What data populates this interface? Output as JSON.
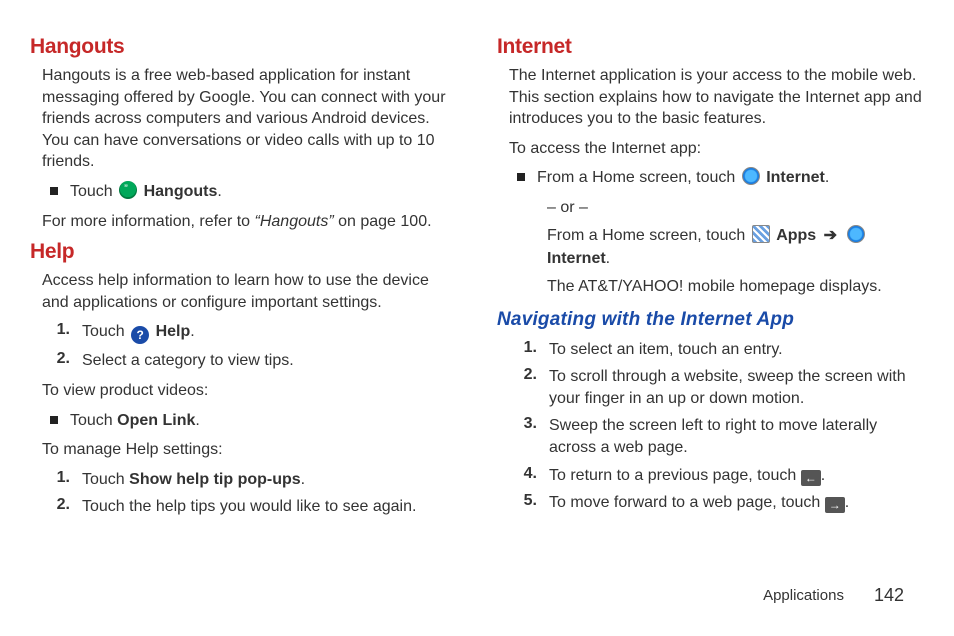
{
  "left": {
    "hangouts": {
      "heading": "Hangouts",
      "desc": "Hangouts is a free web-based application for instant messaging offered by Google. You can connect with your friends across computers and various Android devices. You can have conversations or video calls with up to 10 friends.",
      "bullet_prefix": "Touch ",
      "bullet_bold": "Hangouts",
      "bullet_suffix": ".",
      "ref_prefix": "For more information, refer to ",
      "ref_italic": "“Hangouts”",
      "ref_suffix": " on page 100."
    },
    "help": {
      "heading": "Help",
      "desc": "Access help information to learn how to use the device and applications or configure important settings.",
      "step1_prefix": "Touch ",
      "step1_bold": "Help",
      "step1_suffix": ".",
      "step2": "Select a category to view tips.",
      "videos_para": "To view product videos:",
      "videos_bullet_prefix": "Touch ",
      "videos_bullet_bold": "Open Link",
      "videos_bullet_suffix": ".",
      "settings_para": "To manage Help settings:",
      "setstep1_prefix": "Touch ",
      "setstep1_bold": "Show help tip pop-ups",
      "setstep1_suffix": ".",
      "setstep2": "Touch the help tips you would like to see again.",
      "n1": "1.",
      "n2": "2."
    }
  },
  "right": {
    "internet": {
      "heading": "Internet",
      "desc": "The Internet application is your access to the mobile web. This section explains how to navigate the Internet app and introduces you to the basic features.",
      "access_para": "To access the Internet app:",
      "b1_prefix": "From a Home screen, touch ",
      "b1_bold": "Internet",
      "b1_suffix": ".",
      "or": "– or –",
      "b2_prefix": "From a Home screen, touch ",
      "b2_apps": "Apps",
      "b2_arrow": "➔",
      "b2_internet": "Internet",
      "b2_suffix": ".",
      "homepage": "The AT&T/YAHOO! mobile homepage displays."
    },
    "nav": {
      "heading": "Navigating with the Internet App",
      "s1": "To select an item, touch an entry.",
      "s2": "To scroll through a website, sweep the screen with your finger in an up or down motion.",
      "s3": "Sweep the screen left to right to move laterally across a web page.",
      "s4_prefix": "To return to a previous page, touch ",
      "s4_suffix": ".",
      "s5_prefix": "To move forward to a web page, touch ",
      "s5_suffix": ".",
      "n1": "1.",
      "n2": "2.",
      "n3": "3.",
      "n4": "4.",
      "n5": "5."
    }
  },
  "footer": {
    "section": "Applications",
    "page": "142"
  },
  "icons": {
    "help_glyph": "?",
    "back_glyph": "←",
    "fwd_glyph": "→"
  }
}
